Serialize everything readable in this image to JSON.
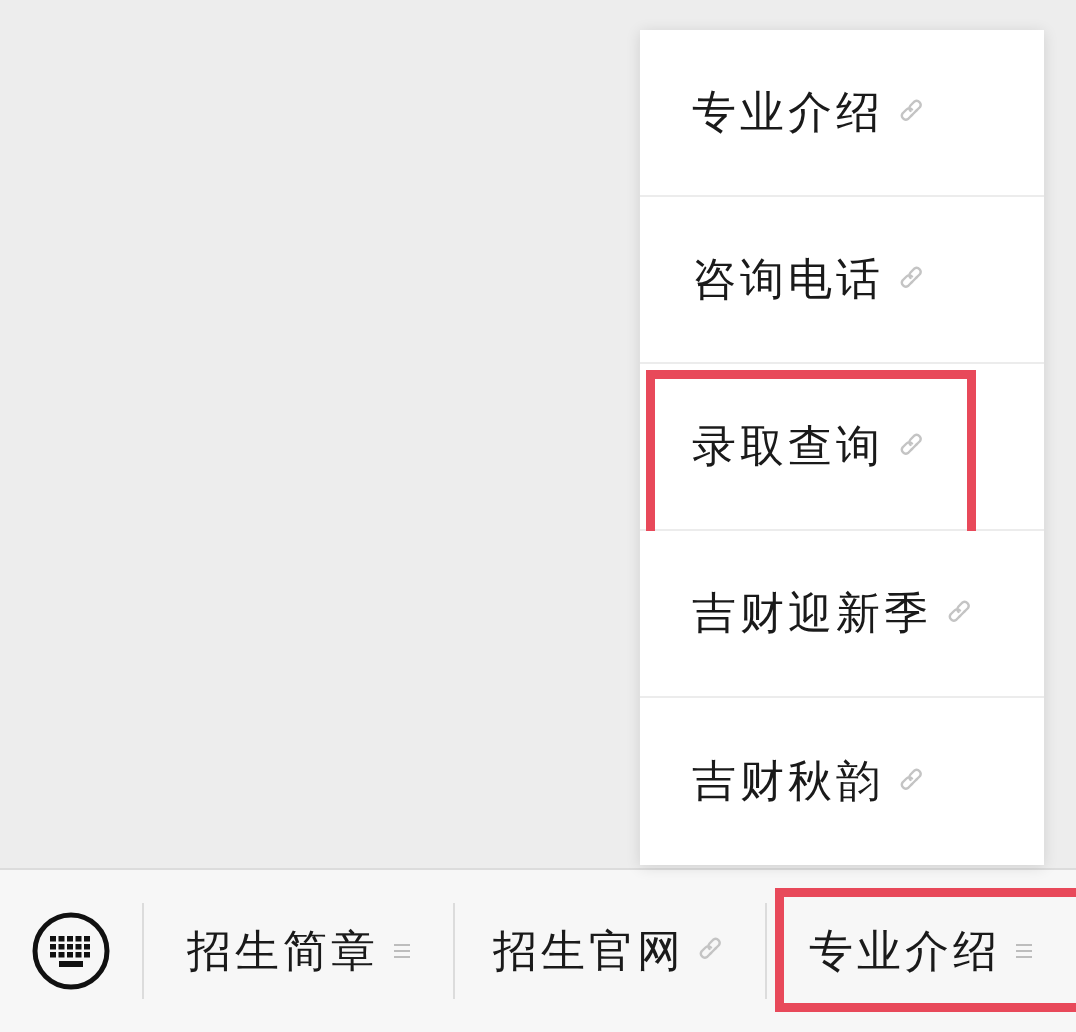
{
  "submenu": {
    "items": [
      {
        "label": "专业介绍",
        "kind": "link",
        "highlighted": false
      },
      {
        "label": "咨询电话",
        "kind": "link",
        "highlighted": false
      },
      {
        "label": "录取查询",
        "kind": "link",
        "highlighted": true
      },
      {
        "label": "吉财迎新季",
        "kind": "link",
        "highlighted": false
      },
      {
        "label": "吉财秋韵",
        "kind": "link",
        "highlighted": false
      }
    ]
  },
  "menu_bar": {
    "items": [
      {
        "label": "招生简章",
        "kind": "submenu",
        "highlighted": false
      },
      {
        "label": "招生官网",
        "kind": "link",
        "highlighted": false
      },
      {
        "label": "专业介绍",
        "kind": "submenu",
        "highlighted": true
      }
    ]
  }
}
